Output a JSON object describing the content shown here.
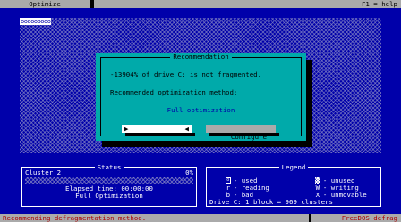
{
  "menubar": {
    "menu": "Optimize",
    "help": "F1 = help"
  },
  "drive_map": {
    "header": "ooooooooo"
  },
  "dialog": {
    "title": "Recommendation",
    "message": "-13904% of drive C: is not fragmented.",
    "method_label": "Recommended optimization method:",
    "method": "Full optimization",
    "optimize_label": "Optimize",
    "optimize_left": "▶",
    "optimize_right": "◀",
    "configure_label": "Configure"
  },
  "status": {
    "title": "Status",
    "cluster": "Cluster 2",
    "percent": "0%",
    "progress": 0,
    "elapsed": "Elapsed time: 00:00:00",
    "method": "Full Optimization"
  },
  "legend": {
    "title": "Legend",
    "items": [
      {
        "symbol": "o",
        "label": "- used"
      },
      {
        "symbol": "",
        "label": "- unused"
      },
      {
        "symbol": "r",
        "label": "- reading"
      },
      {
        "symbol": "W",
        "label": "- writing"
      },
      {
        "symbol": "b",
        "label": "- bad"
      },
      {
        "symbol": "X",
        "label": "- unmovable"
      }
    ],
    "drive_info": "Drive C: 1 block = 969 clusters"
  },
  "statusbar": {
    "message": "Recommending defragmentation method.",
    "brand": "FreeDOS defrag"
  },
  "colors": {
    "background": "#0000aa",
    "dialog": "#00aaaa",
    "menubar": "#aaaaaa",
    "statusbar_text": "#aa0000"
  }
}
